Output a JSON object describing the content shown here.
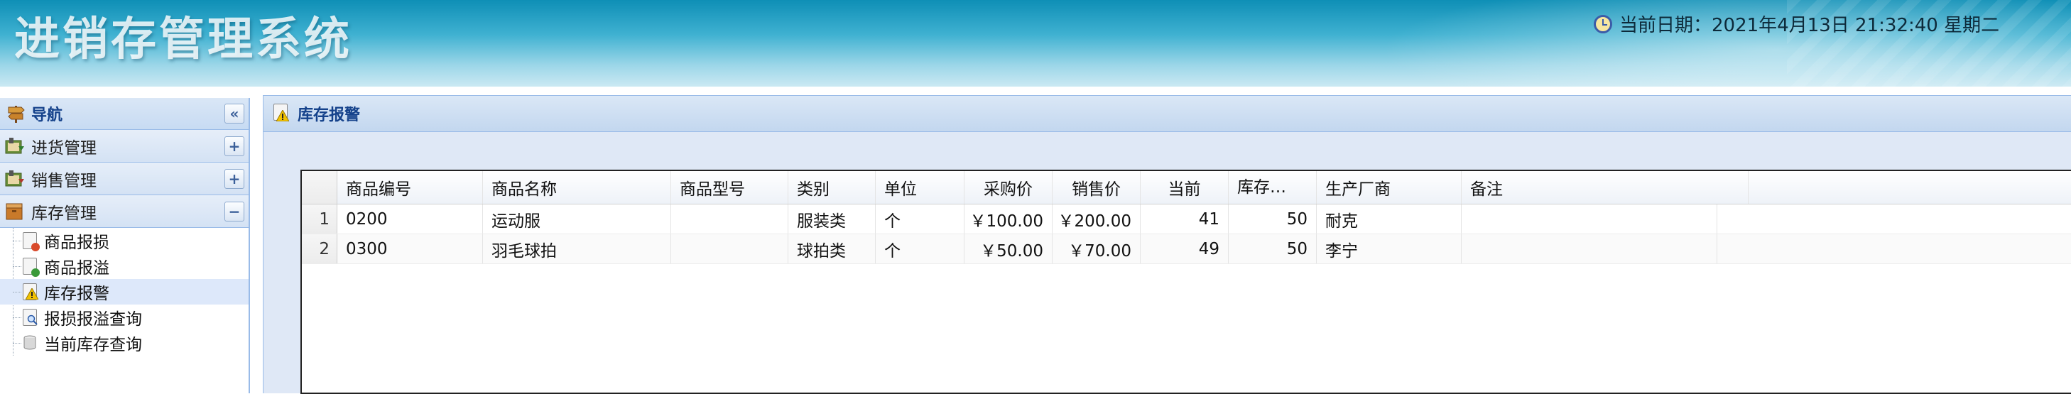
{
  "header": {
    "system_title": "进销存管理系统",
    "datetime_text": "当前日期：2021年4月13日 21:32:40 星期二"
  },
  "nav": {
    "title": "导航",
    "collapse_symbol": "«",
    "groups": [
      {
        "label": "进货管理",
        "toggle": "+"
      },
      {
        "label": "销售管理",
        "toggle": "+"
      },
      {
        "label": "库存管理",
        "toggle": "−"
      }
    ],
    "items": [
      {
        "label": "商品报损",
        "icon": "report-loss-icon"
      },
      {
        "label": "商品报溢",
        "icon": "report-overflow-icon"
      },
      {
        "label": "库存报警",
        "icon": "stock-alarm-icon"
      },
      {
        "label": "报损报溢查询",
        "icon": "query-icon"
      },
      {
        "label": "当前库存查询",
        "icon": "stock-query-icon"
      }
    ],
    "selected_item": "库存报警"
  },
  "panel": {
    "title": "库存报警"
  },
  "table": {
    "columns": [
      "商品编号",
      "商品名称",
      "商品型号",
      "类别",
      "单位",
      "采购价",
      "销售价",
      "当前",
      "库存…",
      "生产厂商",
      "备注"
    ],
    "rows": [
      {
        "num": "1",
        "code": "0200",
        "name": "运动服",
        "model": "",
        "category": "服装类",
        "unit": "个",
        "purchase": "￥100.00",
        "sale": "￥200.00",
        "current": "41",
        "stock": "50",
        "maker": "耐克",
        "remark": ""
      },
      {
        "num": "2",
        "code": "0300",
        "name": "羽毛球拍",
        "model": "",
        "category": "球拍类",
        "unit": "个",
        "purchase": "￥50.00",
        "sale": "￥70.00",
        "current": "49",
        "stock": "50",
        "maker": "李宁",
        "remark": ""
      }
    ]
  },
  "colors": {
    "header_gradient_top": "#0e8fb6",
    "panel_title": "#15428b",
    "panel_bg": "#dfe8f6",
    "border": "#99bbe8",
    "selected_row": "#dde8fa"
  }
}
